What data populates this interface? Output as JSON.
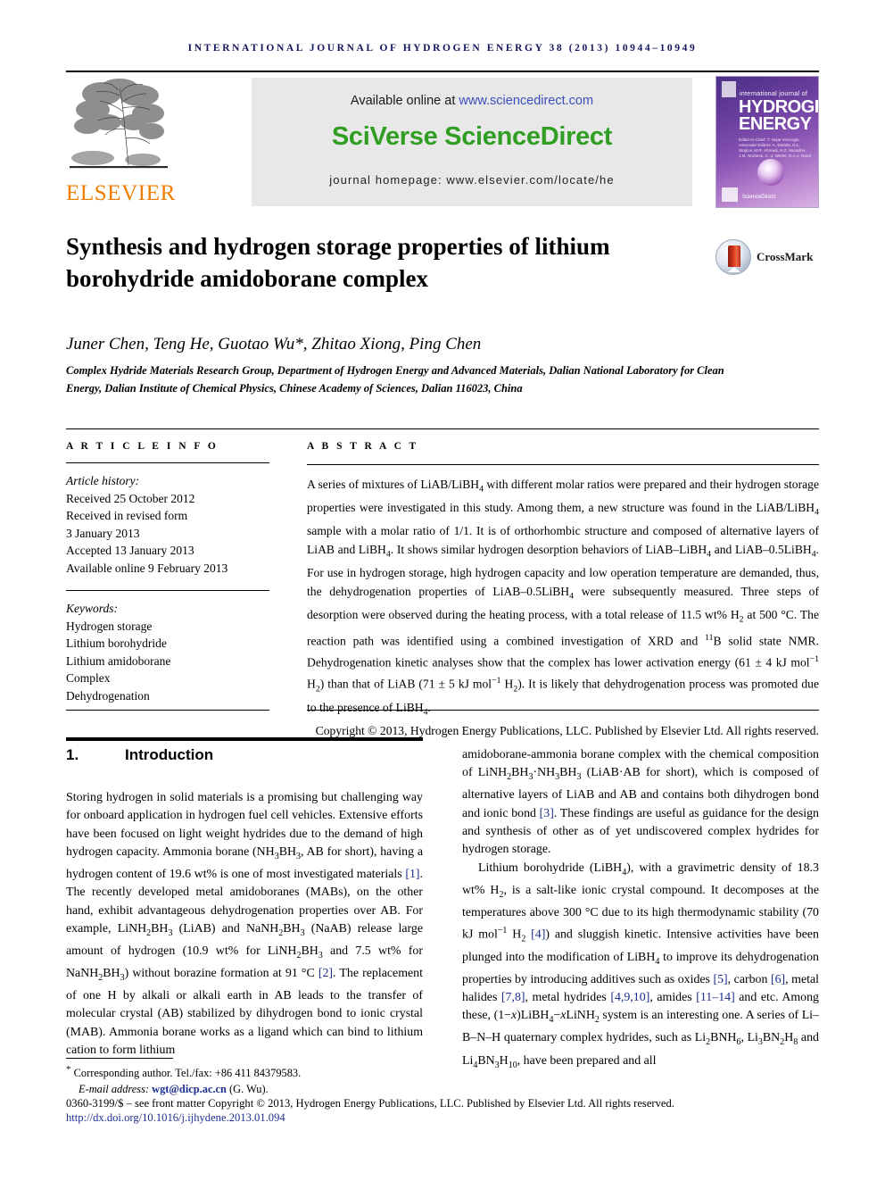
{
  "running_head": "INTERNATIONAL JOURNAL OF HYDROGEN ENERGY 38 (2013) 10944–10949",
  "masthead": {
    "publisher_name": "ELSEVIER",
    "available_prefix": "Available online at ",
    "available_url": "www.sciencedirect.com",
    "platform_title": "SciVerse ScienceDirect",
    "homepage_line": "journal homepage: www.elsevier.com/locate/he",
    "cover": {
      "small_title": "international journal of",
      "line1": "HYDROGEN",
      "line2": "ENERGY",
      "editors": "Editor-in-Chief: T. Nejat Veziroglu\nAssociate Editors: A. Bartels, D.L. Stojkov, M.R. Ahmadi, N.Z. Muradov, J.M. Norbeck, C.-J. Winter, D.A.J. Rand",
      "sciencedirect_label": "ScienceDirect"
    }
  },
  "article": {
    "title": "Synthesis and hydrogen storage properties of lithium borohydride amidoborane complex",
    "crossmark_label": "CrossMark",
    "authors": "Juner Chen, Teng He, Guotao Wu*, Zhitao Xiong, Ping Chen",
    "affiliation": "Complex Hydride Materials Research Group, Department of Hydrogen Energy and Advanced Materials, Dalian National Laboratory for Clean Energy, Dalian Institute of Chemical Physics, Chinese Academy of Sciences, Dalian 116023, China"
  },
  "article_info": {
    "heading": "A R T I C L E   I N F O",
    "history_label": "Article history:",
    "history": [
      "Received 25 October 2012",
      "Received in revised form",
      "3 January 2013",
      "Accepted 13 January 2013",
      "Available online 9 February 2013"
    ],
    "keywords_label": "Keywords:",
    "keywords": [
      "Hydrogen storage",
      "Lithium borohydride",
      "Lithium amidoborane",
      "Complex",
      "Dehydrogenation"
    ]
  },
  "abstract": {
    "heading": "A B S T R A C T",
    "copyright": "Copyright © 2013, Hydrogen Energy Publications, LLC. Published by Elsevier Ltd. All rights reserved."
  },
  "sections": {
    "intro_number": "1.",
    "intro_title": "Introduction"
  },
  "footer": {
    "corresponding": "Corresponding author. Tel./fax: +86 411 84379583.",
    "email_label": "E-mail address: ",
    "email": "wgt@dicp.ac.cn",
    "email_suffix": " (G. Wu).",
    "issn": "0360-3199/$ – see front matter Copyright © 2013, Hydrogen Energy Publications, LLC. Published by Elsevier Ltd. All rights reserved.",
    "doi": "http://dx.doi.org/10.1016/j.ijhydene.2013.01.094"
  },
  "colors": {
    "running_head": "#15175c",
    "elsevier_orange": "#ef7d00",
    "sciencedirect_green": "#2f9e22",
    "link_blue": "#3b4fbe",
    "reference_blue": "#1d2f8f"
  }
}
